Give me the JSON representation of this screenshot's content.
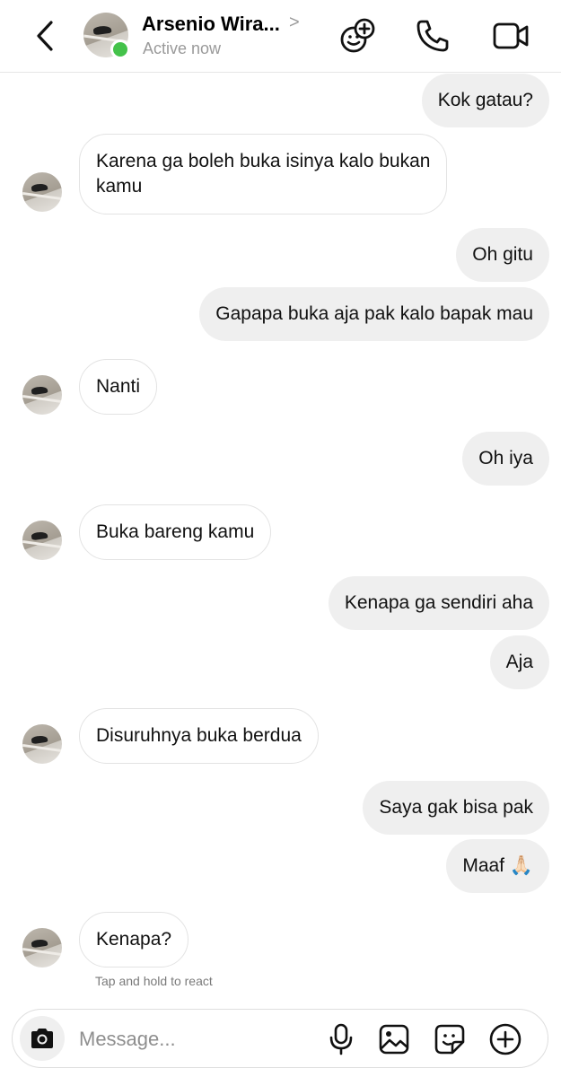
{
  "header": {
    "contact_name": "Arsenio Wira...",
    "chevron": ">",
    "status": "Active now",
    "icons": {
      "back": "back-chevron-icon",
      "effects": "chat-effects-icon",
      "call": "phone-icon",
      "video": "video-camera-icon"
    }
  },
  "messages": [
    {
      "from": "me",
      "text": "Kok gatau?"
    },
    {
      "from": "them",
      "text": "Karena ga boleh buka isinya kalo bukan\nkamu"
    },
    {
      "from": "me",
      "text": "Oh gitu"
    },
    {
      "from": "me",
      "text": "Gapapa buka aja pak kalo bapak mau"
    },
    {
      "from": "them",
      "text": "Nanti"
    },
    {
      "from": "me",
      "text": "Oh iya"
    },
    {
      "from": "them",
      "text": "Buka bareng kamu"
    },
    {
      "from": "me",
      "text": "Kenapa ga sendiri aha"
    },
    {
      "from": "me",
      "text": "Aja"
    },
    {
      "from": "them",
      "text": "Disuruhnya buka berdua"
    },
    {
      "from": "me",
      "text": "Saya gak bisa pak"
    },
    {
      "from": "me",
      "text": "Maaf 🙏🏻"
    },
    {
      "from": "them",
      "text": "Kenapa?"
    }
  ],
  "react_hint": "Tap and hold to react",
  "composer": {
    "placeholder": "Message...",
    "icons": [
      "camera-icon",
      "microphone-icon",
      "gallery-icon",
      "sticker-icon",
      "add-icon"
    ]
  },
  "colors": {
    "sent_bubble": "#efefef",
    "received_border": "#e3e3e3",
    "online": "#44c24a"
  }
}
